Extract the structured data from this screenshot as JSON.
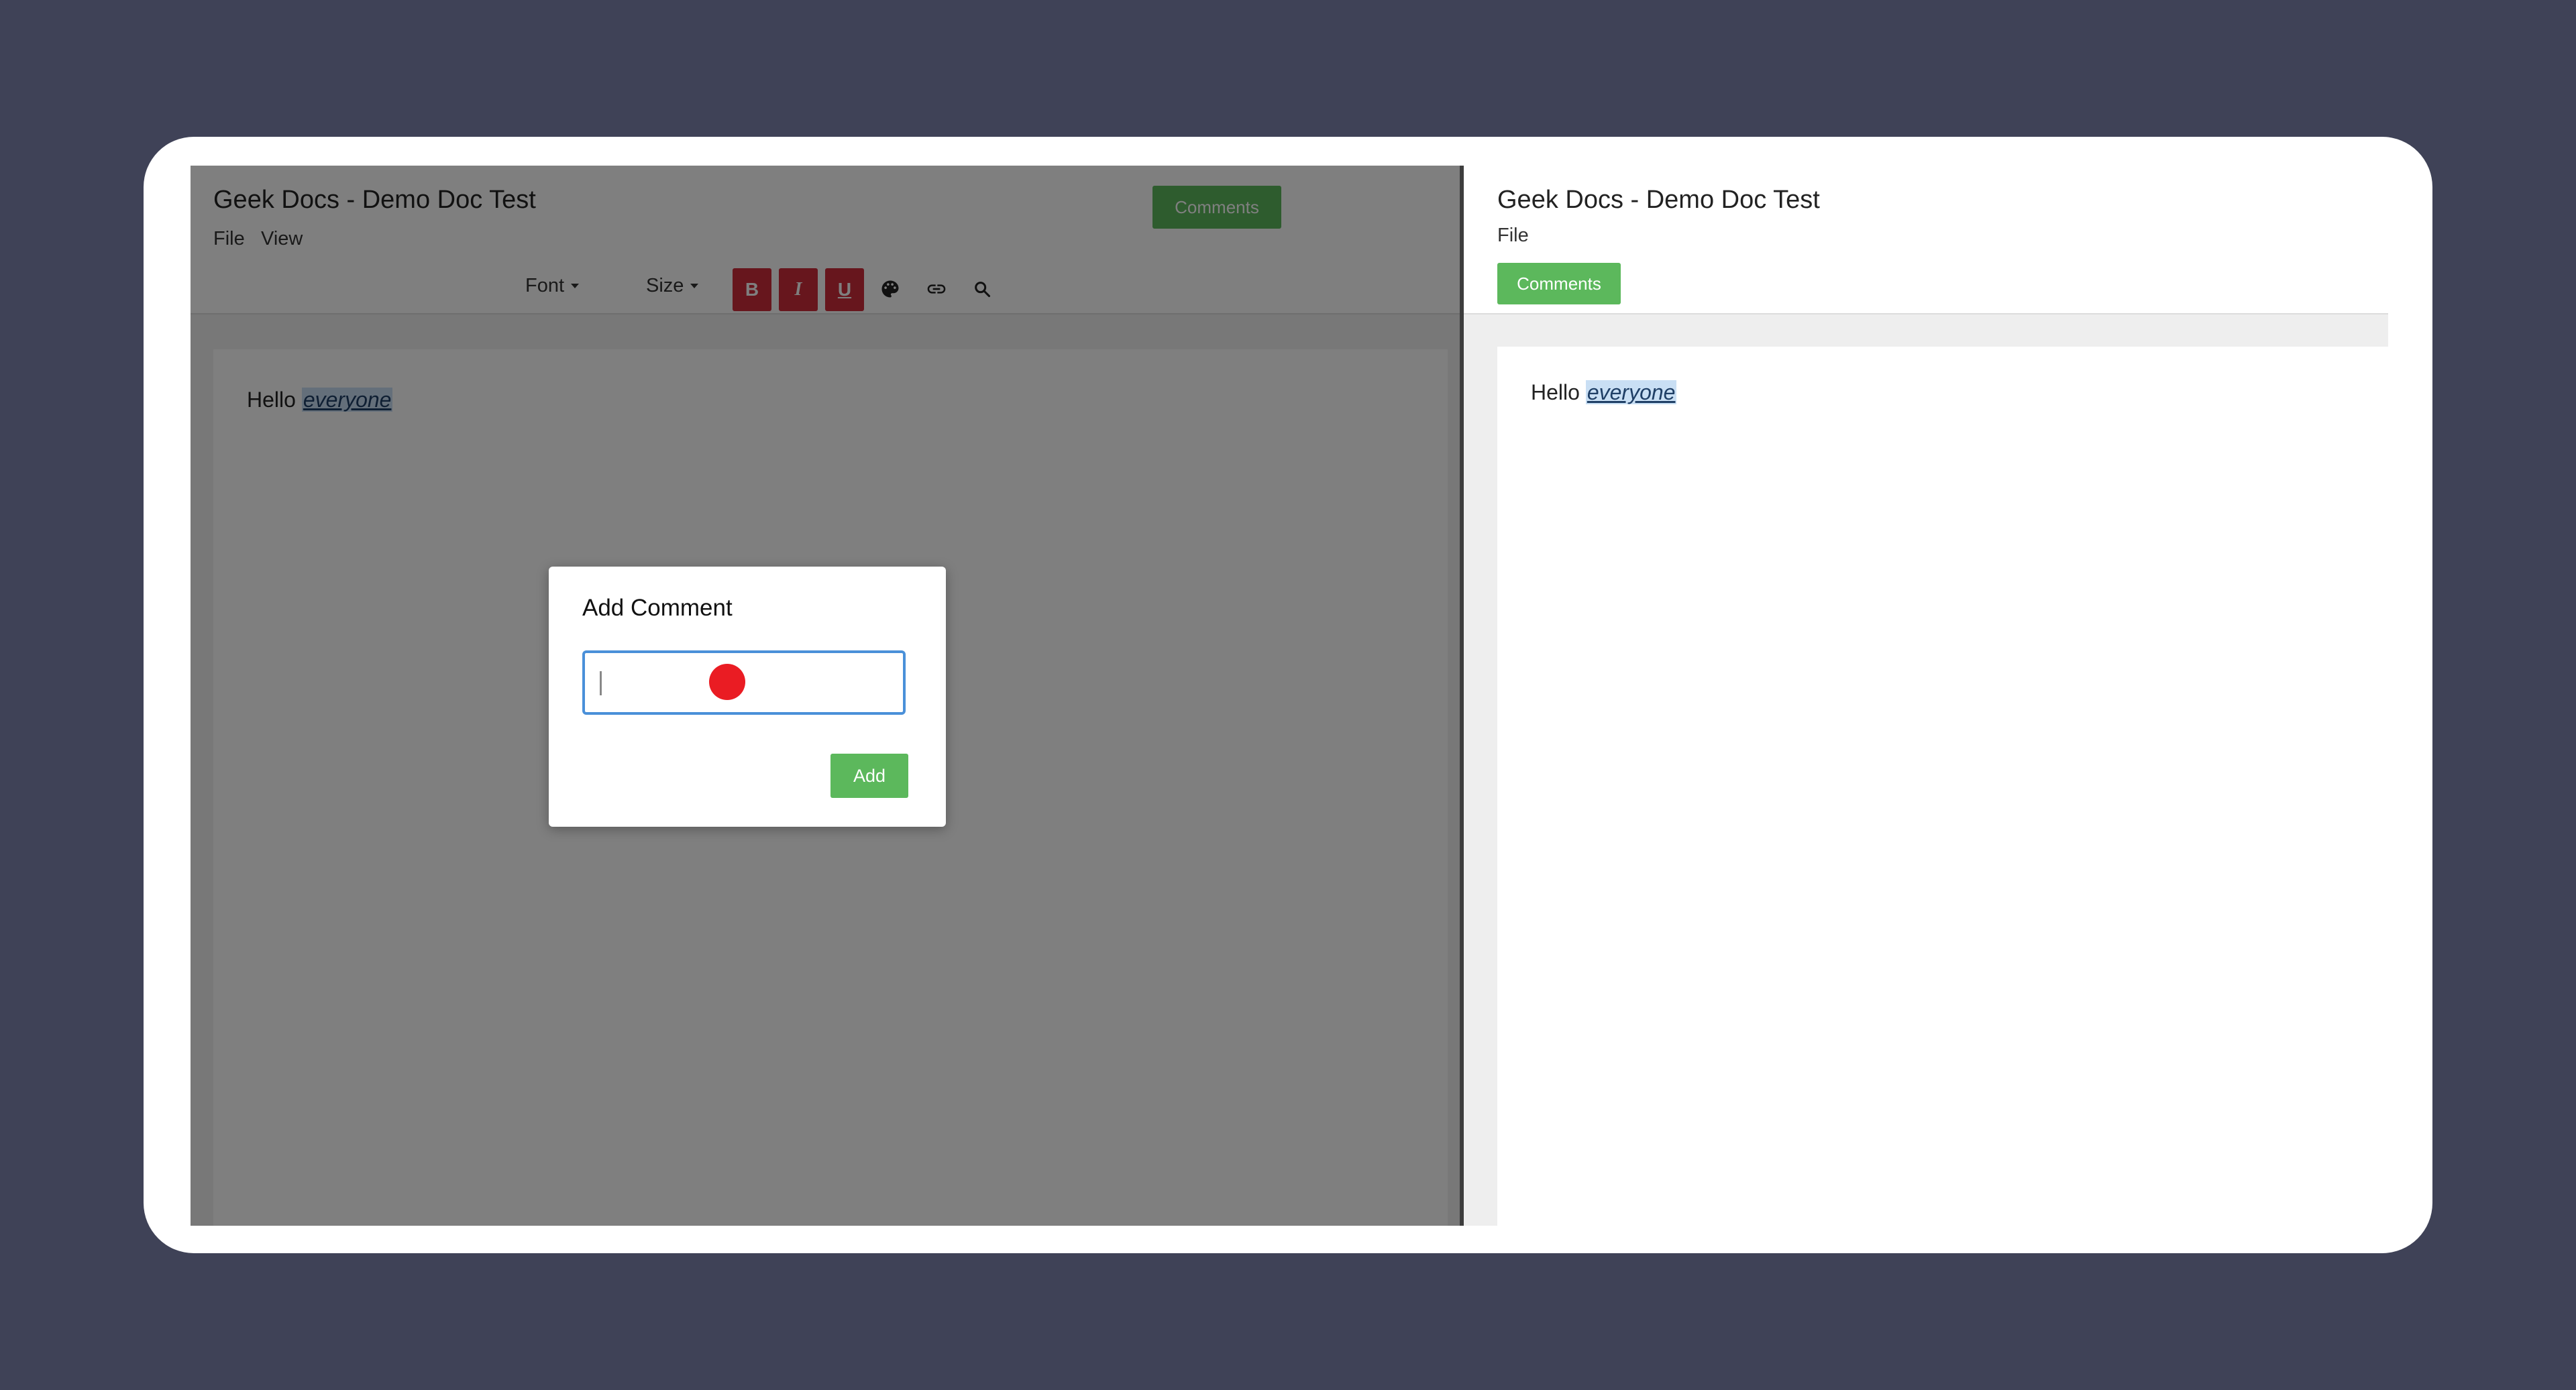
{
  "left": {
    "title": "Geek Docs - Demo Doc Test",
    "menu": [
      "File",
      "View"
    ],
    "comments_button": "Comments",
    "toolbar": {
      "font_label": "Font",
      "size_label": "Size",
      "bold": "B",
      "italic": "I",
      "underline": "U",
      "icons": [
        "palette-icon",
        "link-icon",
        "search-icon"
      ]
    },
    "doc": {
      "plain": "Hello",
      "highlight": "everyone"
    }
  },
  "modal": {
    "title": "Add Comment",
    "input_value": "",
    "add_button": "Add"
  },
  "right": {
    "title": "Geek Docs - Demo Doc Test",
    "menu": [
      "File"
    ],
    "comments_button": "Comments",
    "doc": {
      "plain": "Hello",
      "highlight": "everyone"
    }
  },
  "colors": {
    "background": "#3f4257",
    "accent_green": "#5cb85c",
    "format_red": "#cf2c3a",
    "highlight": "#c9dff4",
    "cursor_red": "#ea1c23",
    "input_border": "#4a90d9"
  }
}
